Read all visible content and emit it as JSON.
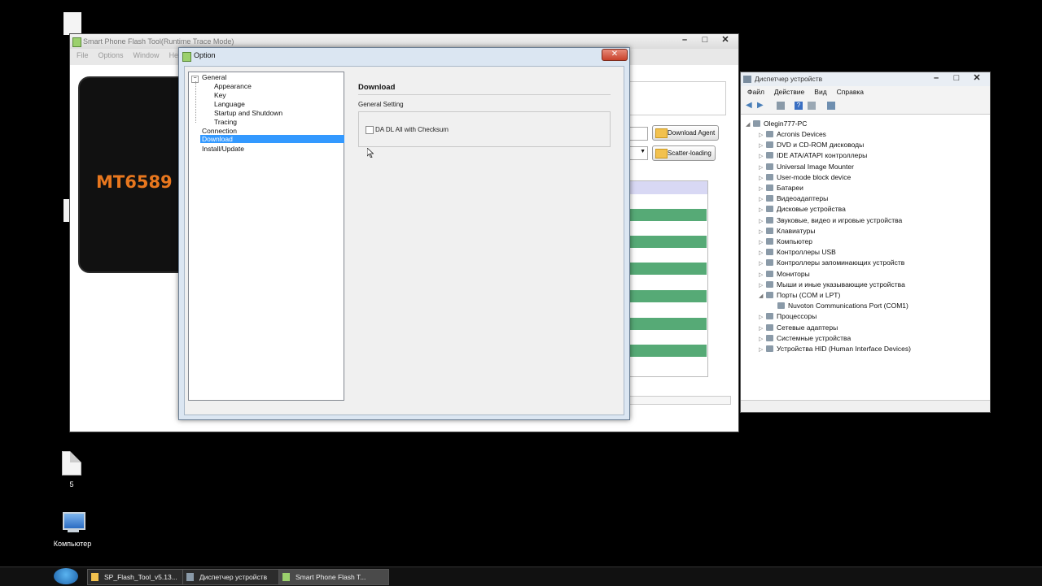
{
  "desktop": {
    "icons": [
      {
        "label": "5",
        "icon": "file-icon"
      },
      {
        "label": "Компьютер",
        "icon": "computer-icon"
      }
    ]
  },
  "flash_tool": {
    "title": "Smart Phone Flash Tool(Runtime Trace Mode)",
    "menu": [
      "File",
      "Options",
      "Window",
      "He"
    ],
    "phone_label": "MT6589",
    "download_agent_label": "Download Agent",
    "scatter_loading_label": "Scatter-loading"
  },
  "option_dialog": {
    "title": "Option",
    "close_glyph": "✕",
    "tree": {
      "general": "General",
      "appearance": "Appearance",
      "key": "Key",
      "language": "Language",
      "startup": "Startup and Shutdown",
      "tracing": "Tracing",
      "connection": "Connection",
      "download": "Download",
      "install_update": "Install/Update",
      "selected": "Download"
    },
    "panel_title": "Download",
    "group_label": "General Setting",
    "checkbox_label": "DA DL All with Checksum",
    "checkbox_checked": false
  },
  "device_manager": {
    "title": "Диспетчер устройств",
    "menu": [
      "Файл",
      "Действие",
      "Вид",
      "Справка"
    ],
    "root": "Olegin777-PC",
    "items": [
      "Acronis Devices",
      "DVD и CD-ROM дисководы",
      "IDE ATA/ATAPI контроллеры",
      "Universal Image Mounter",
      "User-mode block device",
      "Батареи",
      "Видеоадаптеры",
      "Дисковые устройства",
      "Звуковые, видео и игровые устройства",
      "Клавиатуры",
      "Компьютер",
      "Контроллеры USB",
      "Контроллеры запоминающих устройств",
      "Мониторы",
      "Мыши и иные указывающие устройства",
      "Порты (COM и LPT)",
      "Процессоры",
      "Сетевые адаптеры",
      "Системные устройства",
      "Устройства HID (Human Interface Devices)"
    ],
    "port_child": "Nuvoton Communications Port (COM1)"
  },
  "taskbar": {
    "buttons": [
      "SP_Flash_Tool_v5.13...",
      "Диспетчер устройств",
      "Smart Phone Flash T..."
    ]
  },
  "colors": {
    "selection": "#3399ff",
    "flash_rows": "#56aa76",
    "phone_text": "#e8771e"
  }
}
